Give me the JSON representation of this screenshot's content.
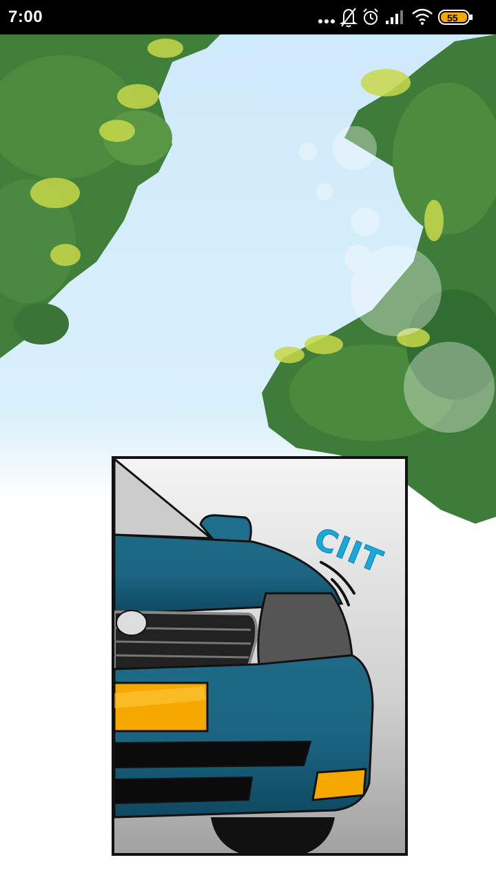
{
  "status_bar": {
    "time": "7:00",
    "battery_level": "55",
    "icons": [
      "more-dots-icon",
      "notifications-off-icon",
      "alarm-icon",
      "signal-icon",
      "wifi-icon",
      "battery-icon"
    ]
  },
  "comic": {
    "sound_effect": "CIIT"
  },
  "colors": {
    "sky": "#cfeafb",
    "leaves": "#3f7f3a",
    "car_body": "#1f6b86",
    "license_plate": "#f5a800",
    "sfx": "#1aa8d8"
  }
}
